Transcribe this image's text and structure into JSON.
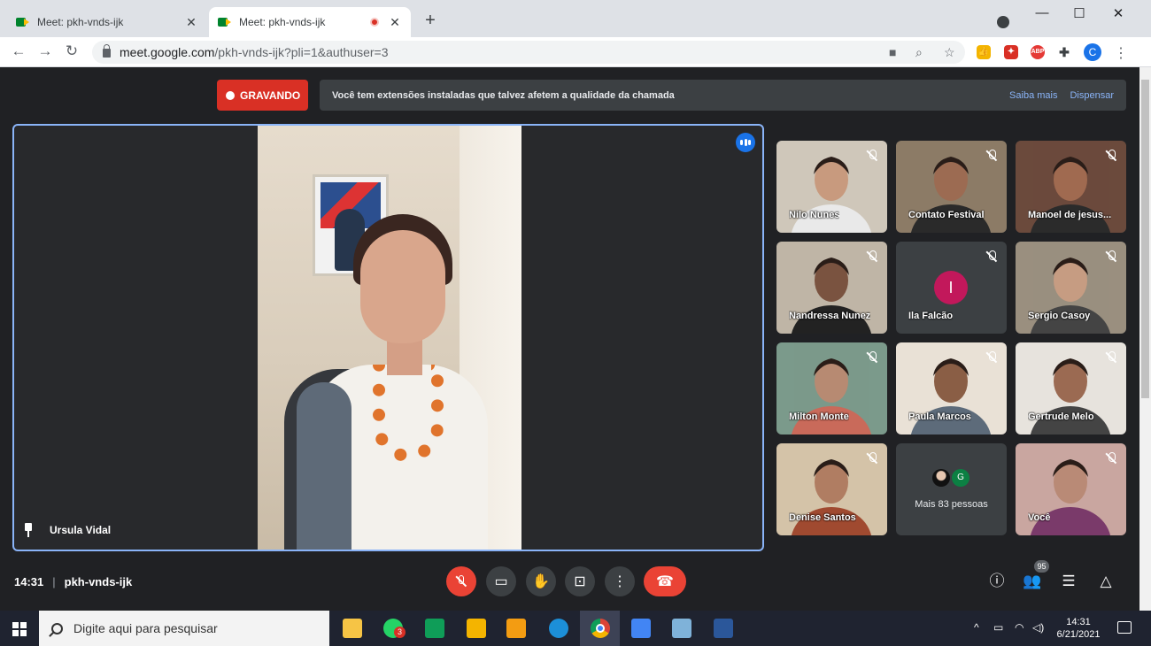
{
  "browser": {
    "tabs": [
      {
        "title": "Meet: pkh-vnds-ijk",
        "active": false
      },
      {
        "title": "Meet: pkh-vnds-ijk",
        "active": true,
        "recording": true
      }
    ],
    "new_tab": "+",
    "url_host": "meet.google.com",
    "url_path": "/pkh-vnds-ijk?pli=1&authuser=3",
    "profile_initial": "C",
    "extensions": [
      {
        "name": "thumb-extension-icon",
        "color": "#f4b400",
        "glyph": "👍"
      },
      {
        "name": "shield-extension-icon",
        "color": "#d93025",
        "glyph": "✦"
      },
      {
        "name": "adblock-extension-icon",
        "color": "#e53935",
        "glyph": "ABP"
      },
      {
        "name": "puzzle-extensions-icon",
        "color": "#5f6368",
        "glyph": "✚"
      }
    ]
  },
  "meet": {
    "recording_label": "GRAVANDO",
    "banner_message": "Você tem extensões instaladas que talvez afetem a qualidade da chamada",
    "banner_learn_more": "Saiba mais",
    "banner_dismiss": "Dispensar",
    "presenter_name": "Ursula Vidal",
    "participants": [
      {
        "name": "Nilo Nunes",
        "bg": "#cfc7ba",
        "skin": "#c89a7e",
        "shirt": "#e9e9e9"
      },
      {
        "name": "Contato Festival",
        "bg": "#8c7b66",
        "skin": "#9c6b52",
        "shirt": "#2a2a2a"
      },
      {
        "name": "Manoel de jesus...",
        "bg": "#6b4a3c",
        "skin": "#a06a50",
        "shirt": "#2b2b2b"
      },
      {
        "name": "Nandressa Nunez",
        "bg": "#bfb5a6",
        "skin": "#7a5340",
        "shirt": "#222"
      },
      {
        "name": "Ila Falcão",
        "initial": "I"
      },
      {
        "name": "Sergio Casoy",
        "bg": "#9a8f7f",
        "skin": "#c69c82",
        "shirt": "#444"
      },
      {
        "name": "Milton Monte",
        "bg": "#7b9a8b",
        "skin": "#b78a72",
        "shirt": "#c96a5a"
      },
      {
        "name": "Paula Marcos",
        "bg": "#e9e1d6",
        "skin": "#8a5e45",
        "shirt": "#5d6b7a"
      },
      {
        "name": "Gertrude Melo",
        "bg": "#e7e3dd",
        "skin": "#9b6a52",
        "shirt": "#444"
      },
      {
        "name": "Denise Santos",
        "bg": "#d4c3a8",
        "skin": "#b07d62",
        "shirt": "#a04a30"
      },
      {
        "name": "Mais 83 pessoas",
        "more": true,
        "avatar_initial": "G"
      },
      {
        "name": "Você",
        "bg": "#c9a6a0",
        "skin": "#b98a76",
        "shirt": "#7a3a6a"
      }
    ],
    "time": "14:31",
    "meeting_code": "pkh-vnds-ijk",
    "participant_count": "95"
  },
  "taskbar": {
    "search_placeholder": "Digite aqui para pesquisar",
    "whatsapp_badge": "3",
    "clock_time": "14:31",
    "clock_date": "6/21/2021",
    "apps": [
      {
        "name": "file-explorer-icon",
        "color": "#f6c445"
      },
      {
        "name": "whatsapp-icon",
        "color": "#25d366"
      },
      {
        "name": "sheets-icon",
        "color": "#0f9d58"
      },
      {
        "name": "slides-icon",
        "color": "#f4b400"
      },
      {
        "name": "h-app-icon",
        "color": "#f39c12"
      },
      {
        "name": "edge-icon",
        "color": "#1c8fd8"
      },
      {
        "name": "chrome-icon",
        "color": "#db4437"
      },
      {
        "name": "docs-icon",
        "color": "#4285f4"
      },
      {
        "name": "notes-icon",
        "color": "#7fb2d9"
      },
      {
        "name": "word-icon",
        "color": "#2b579a"
      }
    ]
  }
}
